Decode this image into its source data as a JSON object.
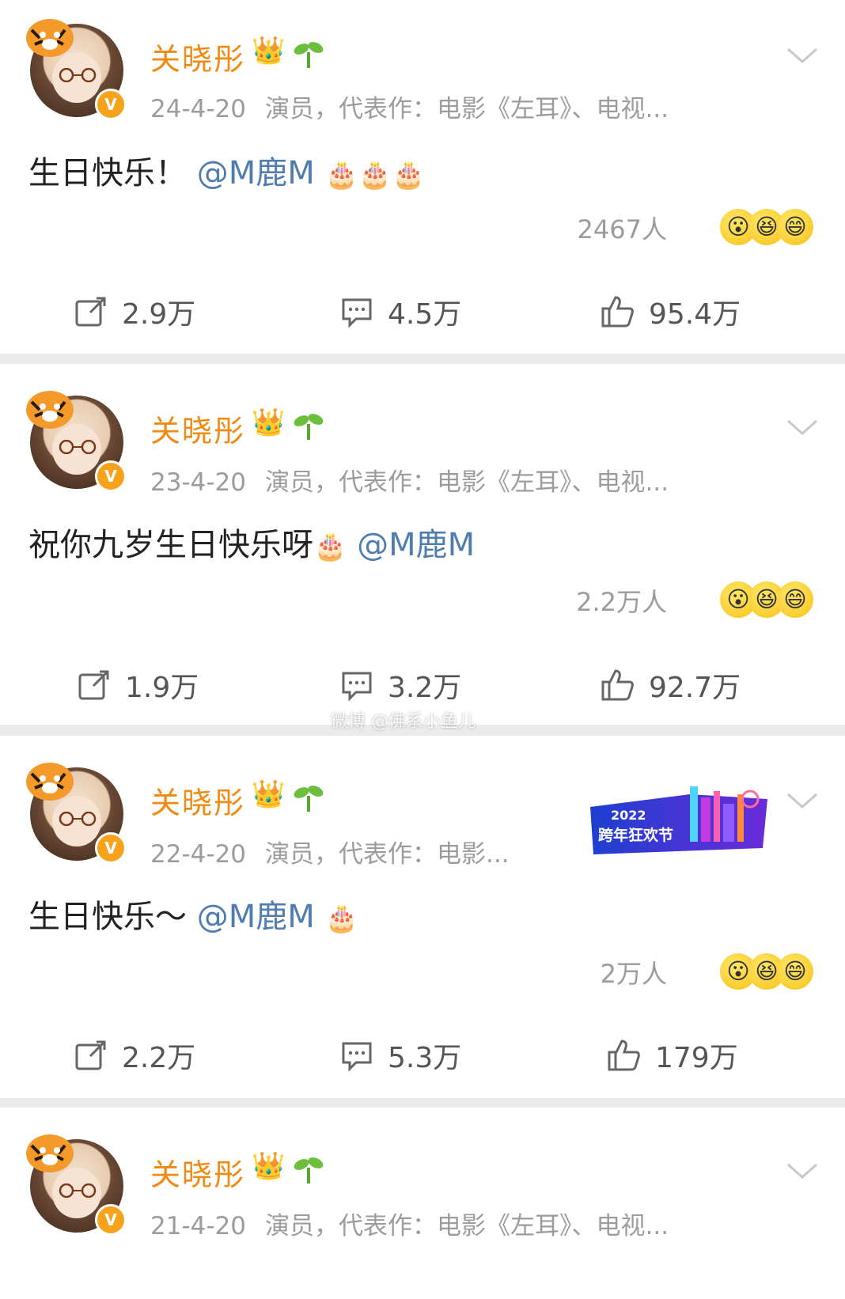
{
  "posts": [
    {
      "author": "关晓彤",
      "date": "24-4-20",
      "bio": "演员，代表作：电影《左耳》、电视...",
      "text_main": "生日快乐！",
      "mention": "@M鹿M",
      "cakes": "🎂🎂🎂",
      "reaction_count": "2467人",
      "reposts": "2.9万",
      "comments": "4.5万",
      "likes": "95.4万"
    },
    {
      "author": "关晓彤",
      "date": "23-4-20",
      "bio": "演员，代表作：电影《左耳》、电视...",
      "text_main": "祝你九岁生日快乐呀",
      "mention": "@M鹿M",
      "cakes": "🎂",
      "reaction_count": "2.2万人",
      "reposts": "1.9万",
      "comments": "3.2万",
      "likes": "92.7万"
    },
    {
      "author": "关晓彤",
      "date": "22-4-20",
      "bio": "演员，代表作：电影...",
      "text_main": "生日快乐～",
      "mention": "@M鹿M",
      "cakes": "🎂",
      "reaction_count": "2万人",
      "reposts": "2.2万",
      "comments": "5.3万",
      "likes": "179万",
      "banner_year": "2022",
      "banner_title": "跨年狂欢节"
    },
    {
      "author": "关晓彤",
      "date": "21-4-20",
      "bio": "演员，代表作：电影《左耳》、电视..."
    }
  ],
  "watermark": "微博 @佛系小鱼儿",
  "icons": {
    "verified": "verified-badge-icon",
    "crown": "crown-icon",
    "sprout": "sprout-icon",
    "chevron": "chevron-down-icon",
    "repost": "repost-icon",
    "comment": "comment-icon",
    "like": "like-icon"
  },
  "colors": {
    "author": "#f08a12",
    "mention": "#507daf",
    "meta": "#9c9c9c",
    "verified": "#f7a21b"
  }
}
